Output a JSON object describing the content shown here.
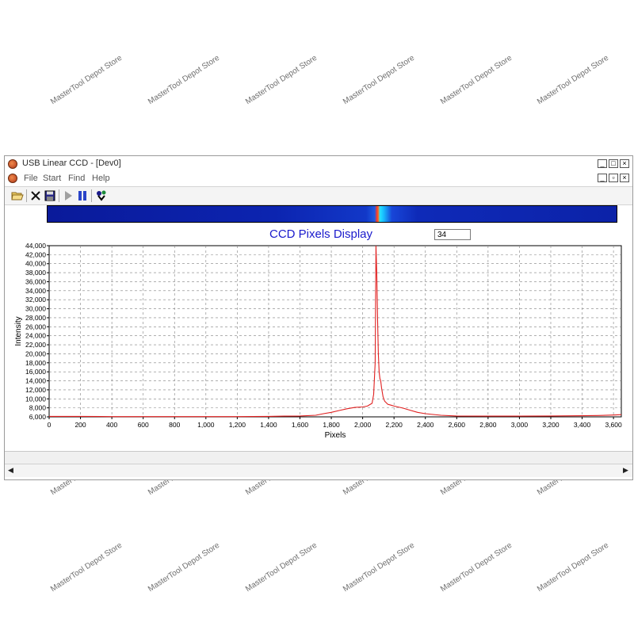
{
  "window": {
    "title": "USB Linear CCD - [Dev0]",
    "controls": {
      "minimize": "_",
      "maximize": "□",
      "close": "×"
    },
    "mdi_controls": {
      "minimize": "_",
      "restore": "▫",
      "close": "×"
    }
  },
  "menu": {
    "items": [
      "File",
      "Start",
      "Find",
      "Help"
    ]
  },
  "toolbar": {
    "buttons": [
      "open-icon",
      "close-doc-icon",
      "save-icon",
      "play-icon",
      "pause-icon",
      "device-icon"
    ]
  },
  "watermark": "MasterTool Depot Store",
  "chart_input": "34",
  "colors": {
    "accent": "#1a1acc",
    "line": "#e02020",
    "grid": "#808080"
  },
  "chart_data": {
    "type": "line",
    "title": "CCD Pixels Display",
    "xlabel": "Pixels",
    "ylabel": "Intensity",
    "xlim": [
      0,
      3650
    ],
    "ylim": [
      6000,
      44000
    ],
    "xticks": [
      0,
      200,
      400,
      600,
      800,
      1000,
      1200,
      1400,
      1600,
      1800,
      2000,
      2200,
      2400,
      2600,
      2800,
      3000,
      3200,
      3400,
      3600
    ],
    "xtick_labels": [
      "0",
      "200",
      "400",
      "600",
      "800",
      "1,000",
      "1,200",
      "1,400",
      "1,600",
      "1,800",
      "2,000",
      "2,200",
      "2,400",
      "2,600",
      "2,800",
      "3,000",
      "3,200",
      "3,400",
      "3,600"
    ],
    "yticks": [
      6000,
      8000,
      10000,
      12000,
      14000,
      16000,
      18000,
      20000,
      22000,
      24000,
      26000,
      28000,
      30000,
      32000,
      34000,
      36000,
      38000,
      40000,
      42000,
      44000
    ],
    "ytick_labels": [
      "6,000",
      "8,000",
      "10,000",
      "12,000",
      "14,000",
      "16,000",
      "18,000",
      "20,000",
      "22,000",
      "24,000",
      "26,000",
      "28,000",
      "30,000",
      "32,000",
      "34,000",
      "36,000",
      "38,000",
      "40,000",
      "42,000",
      "44,000"
    ],
    "grid": true,
    "series": [
      {
        "x": [
          0,
          200,
          400,
          600,
          800,
          1000,
          1200,
          1400,
          1500,
          1600,
          1700,
          1750,
          1800,
          1850,
          1900,
          1950,
          2000,
          2030,
          2060,
          2070,
          2080,
          2085,
          2090,
          2095,
          2100,
          2105,
          2110,
          2115,
          2120,
          2130,
          2140,
          2160,
          2180,
          2200,
          2250,
          2300,
          2350,
          2400,
          2500,
          2600,
          2800,
          3000,
          3200,
          3400,
          3500,
          3600,
          3650
        ],
        "y": [
          6100,
          6100,
          6050,
          6050,
          6050,
          6050,
          6050,
          6100,
          6150,
          6200,
          6350,
          6700,
          7000,
          7400,
          7800,
          8100,
          8200,
          8400,
          9000,
          11000,
          18000,
          44000,
          38000,
          28000,
          20000,
          16000,
          14500,
          14000,
          12500,
          10500,
          9500,
          8800,
          8600,
          8400,
          8000,
          7500,
          7000,
          6700,
          6350,
          6200,
          6150,
          6150,
          6200,
          6250,
          6300,
          6400,
          6500
        ]
      }
    ]
  }
}
